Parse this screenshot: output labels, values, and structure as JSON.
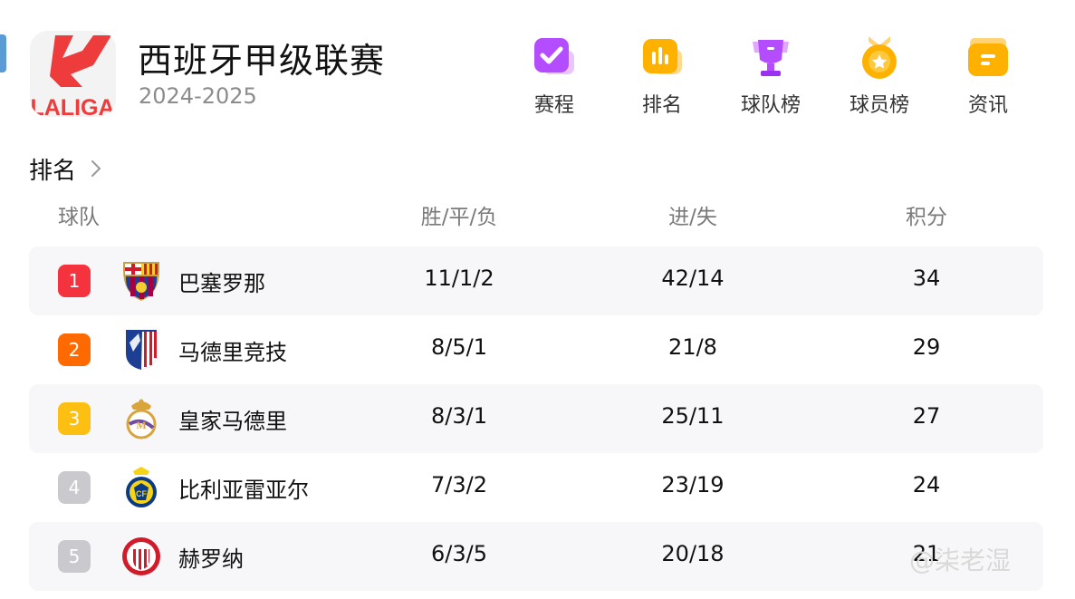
{
  "league": {
    "name": "西班牙甲级联赛",
    "season": "2024-2025",
    "logo_text": "LALIGA"
  },
  "nav": [
    {
      "label": "赛程",
      "icon": "schedule-check-icon"
    },
    {
      "label": "排名",
      "icon": "ranking-bars-icon"
    },
    {
      "label": "球队榜",
      "icon": "trophy-icon"
    },
    {
      "label": "球员榜",
      "icon": "medal-icon"
    },
    {
      "label": "资讯",
      "icon": "news-folder-icon"
    }
  ],
  "standings": {
    "title": "排名",
    "headers": {
      "team": "球队",
      "record": "胜/平/负",
      "goals": "进/失",
      "points": "积分"
    },
    "rows": [
      {
        "rank": "1",
        "team": "巴塞罗那",
        "record": "11/1/2",
        "goals": "42/14",
        "points": "34"
      },
      {
        "rank": "2",
        "team": "马德里竞技",
        "record": "8/5/1",
        "goals": "21/8",
        "points": "29"
      },
      {
        "rank": "3",
        "team": "皇家马德里",
        "record": "8/3/1",
        "goals": "25/11",
        "points": "27"
      },
      {
        "rank": "4",
        "team": "比利亚雷亚尔",
        "record": "7/3/2",
        "goals": "23/19",
        "points": "24"
      },
      {
        "rank": "5",
        "team": "赫罗纳",
        "record": "6/3/5",
        "goals": "20/18",
        "points": "21"
      }
    ]
  },
  "colors": {
    "rank1": "#f5333f",
    "rank2": "#ff6a00",
    "rank3": "#fcbf12",
    "rank_other": "#c9c9ce",
    "row_shade": "#f7f7f9"
  },
  "watermark": "@柒老湿"
}
